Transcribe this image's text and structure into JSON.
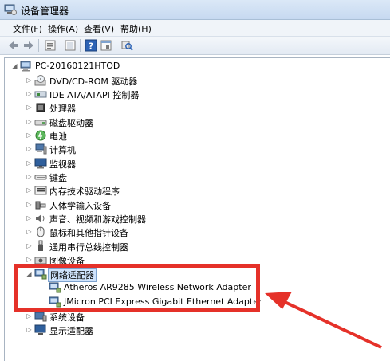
{
  "window": {
    "title": "设备管理器"
  },
  "menu": {
    "file": "文件(F)",
    "action": "操作(A)",
    "view": "查看(V)",
    "help": "帮助(H)"
  },
  "tree": {
    "root": "PC-20160121HTOD",
    "categories": [
      "DVD/CD-ROM 驱动器",
      "IDE ATA/ATAPI 控制器",
      "处理器",
      "磁盘驱动器",
      "电池",
      "计算机",
      "监视器",
      "键盘",
      "内存技术驱动程序",
      "人体学输入设备",
      "声音、视频和游戏控制器",
      "鼠标和其他指针设备",
      "通用串行总线控制器",
      "图像设备"
    ],
    "network": {
      "label": "网络适配器",
      "children": [
        "Atheros AR9285 Wireless Network Adapter",
        "JMicron PCI Express Gigabit Ethernet Adapter"
      ]
    },
    "after": [
      "系统设备",
      "显示适配器"
    ]
  },
  "colors": {
    "highlight": "#e53129",
    "selection": "#cfe3fc"
  }
}
